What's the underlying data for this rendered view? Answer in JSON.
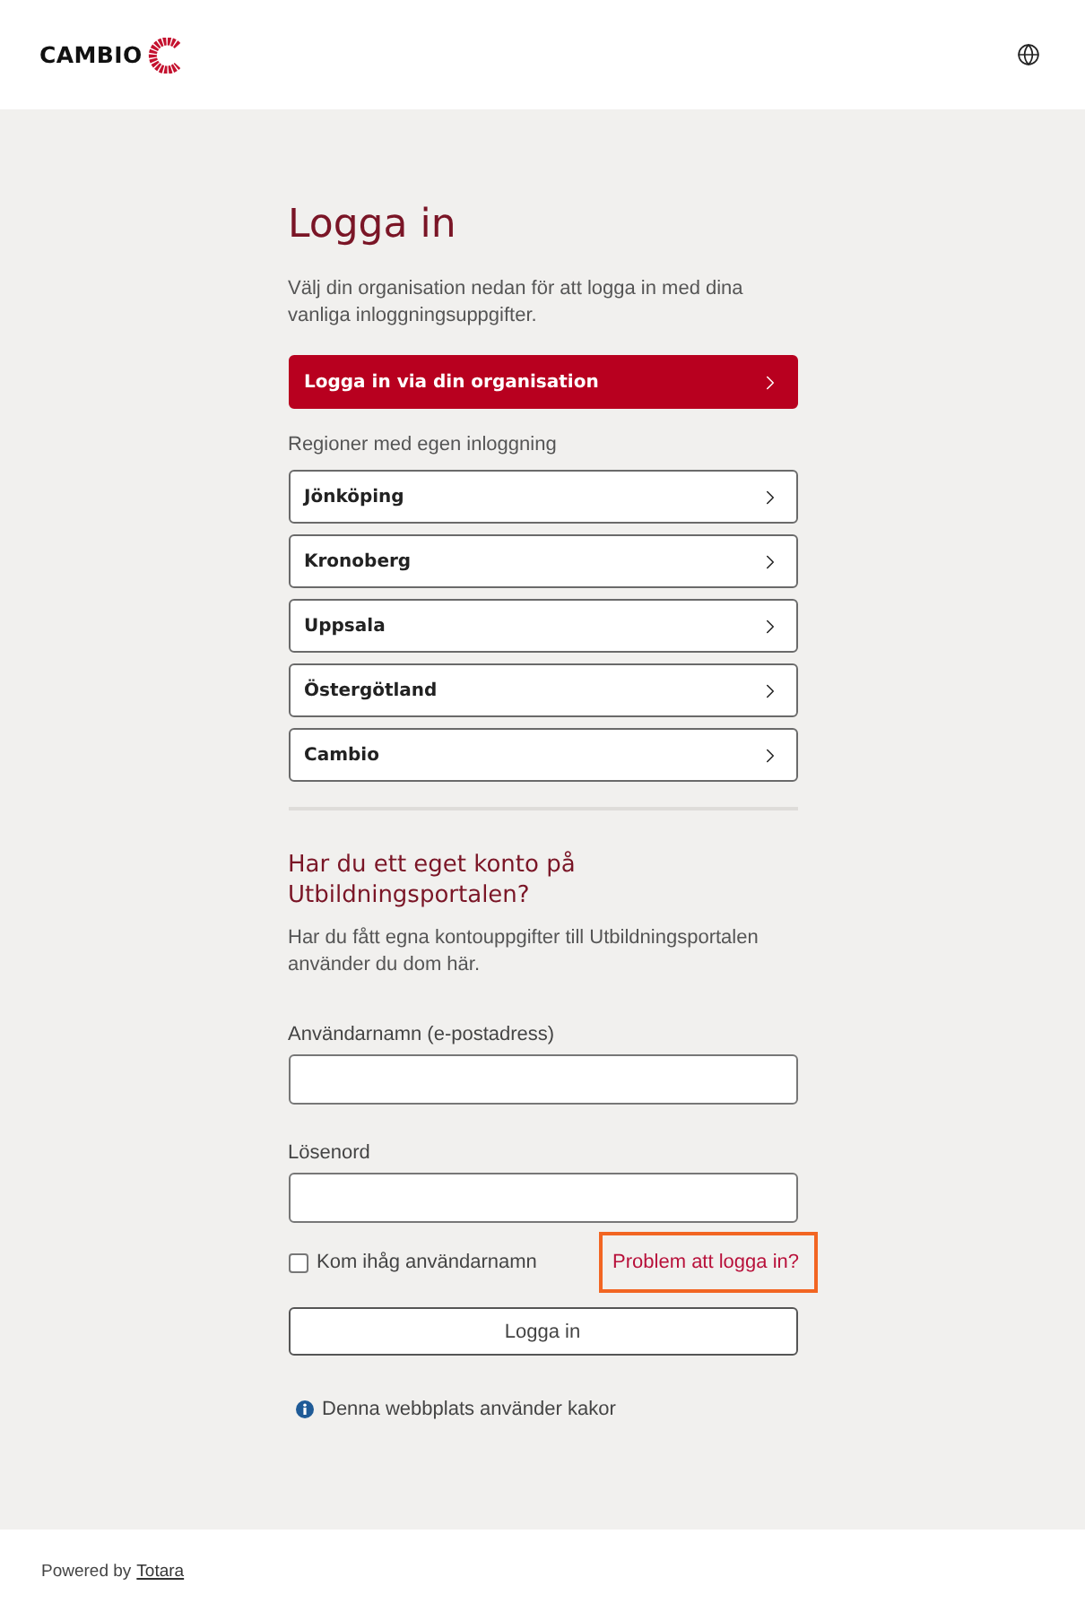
{
  "header": {
    "logo_text": "CAMBIO"
  },
  "login": {
    "title": "Logga in",
    "intro": "Välj din organisation nedan för att logga in med dina vanliga inloggningsuppgifter.",
    "primary_button": {
      "label": "Logga in via din organisation"
    },
    "regions_label": "Regioner med egen inloggning",
    "regions": [
      {
        "label": "Jönköping"
      },
      {
        "label": "Kronoberg"
      },
      {
        "label": "Uppsala"
      },
      {
        "label": "Östergötland"
      },
      {
        "label": "Cambio"
      }
    ]
  },
  "local_login": {
    "heading": "Har du ett eget konto på Utbildningsportalen?",
    "description": "Har du fått egna kontouppgifter till Utbildningsportalen använder du dom här.",
    "fields": [
      {
        "label": "Användarnamn (e-postadress)"
      },
      {
        "label": "Lösenord"
      }
    ],
    "remember": {
      "label": "Kom ihåg användarnamn",
      "checked": false
    },
    "help_link": {
      "label": "Problem att logga in?",
      "highlighted": true
    },
    "submit_button": {
      "label": "Logga in"
    }
  },
  "cookie_notice": "Denna webbplats använder kakor",
  "footer": {
    "powered_by": "Powered by",
    "link": "Totara"
  }
}
